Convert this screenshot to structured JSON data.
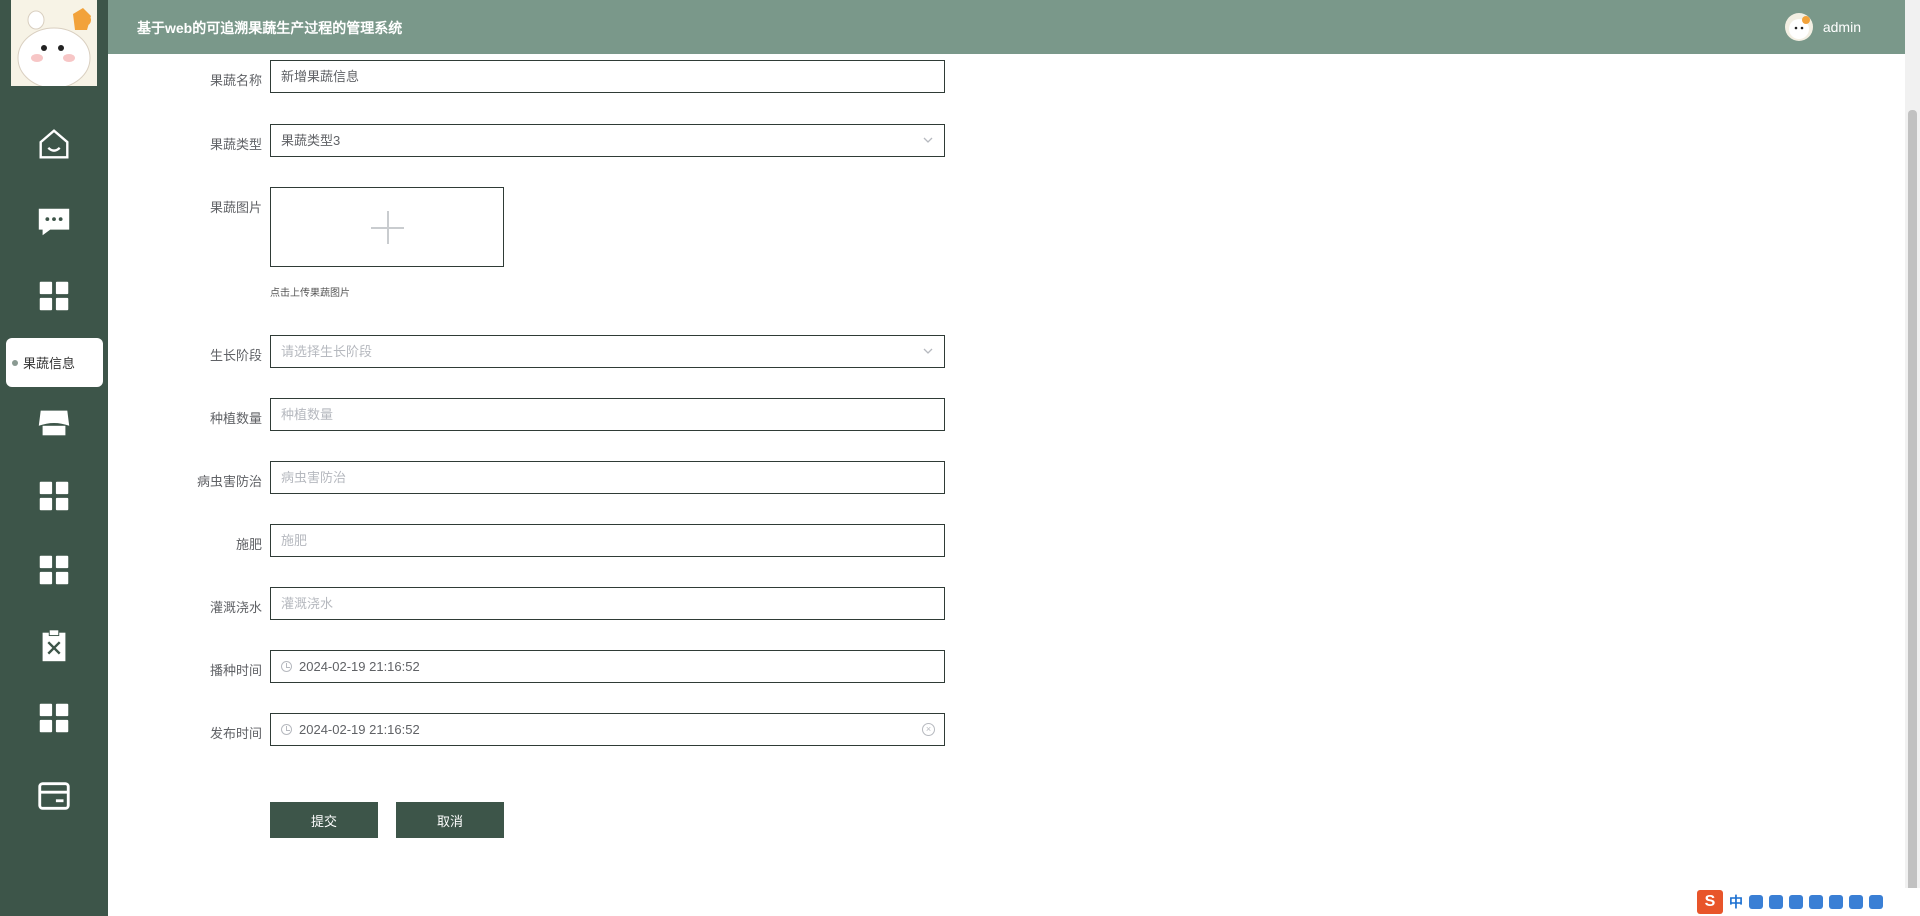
{
  "header": {
    "title": "基于web的可追溯果蔬生产过程的管理系统",
    "username": "admin"
  },
  "sidebar": {
    "nav_icons": [
      "home-icon",
      "chat-icon",
      "grid-icon",
      "store-icon",
      "grid-icon",
      "grid-icon",
      "clipboard-x-icon",
      "grid-icon",
      "card-icon"
    ],
    "active_submenu_label": "果蔬信息"
  },
  "form": {
    "name": {
      "label": "果蔬名称",
      "value": "新增果蔬信息"
    },
    "type": {
      "label": "果蔬类型",
      "value": "果蔬类型3"
    },
    "image": {
      "label": "果蔬图片",
      "tip": "点击上传果蔬图片"
    },
    "stage": {
      "label": "生长阶段",
      "placeholder": "请选择生长阶段"
    },
    "quantity": {
      "label": "种植数量",
      "placeholder": "种植数量"
    },
    "pest": {
      "label": "病虫害防治",
      "placeholder": "病虫害防治"
    },
    "fertilize": {
      "label": "施肥",
      "placeholder": "施肥"
    },
    "irrigate": {
      "label": "灌溉浇水",
      "placeholder": "灌溉浇水"
    },
    "sow_time": {
      "label": "播种时间",
      "value": "2024-02-19 21:16:52"
    },
    "publish_time": {
      "label": "发布时间",
      "value": "2024-02-19 21:16:52"
    }
  },
  "buttons": {
    "submit": "提交",
    "cancel": "取消"
  },
  "ime": {
    "lang": "中"
  },
  "colors": {
    "sidebar": "#3d5549",
    "header": "#7a988a",
    "button": "#3d5549"
  }
}
